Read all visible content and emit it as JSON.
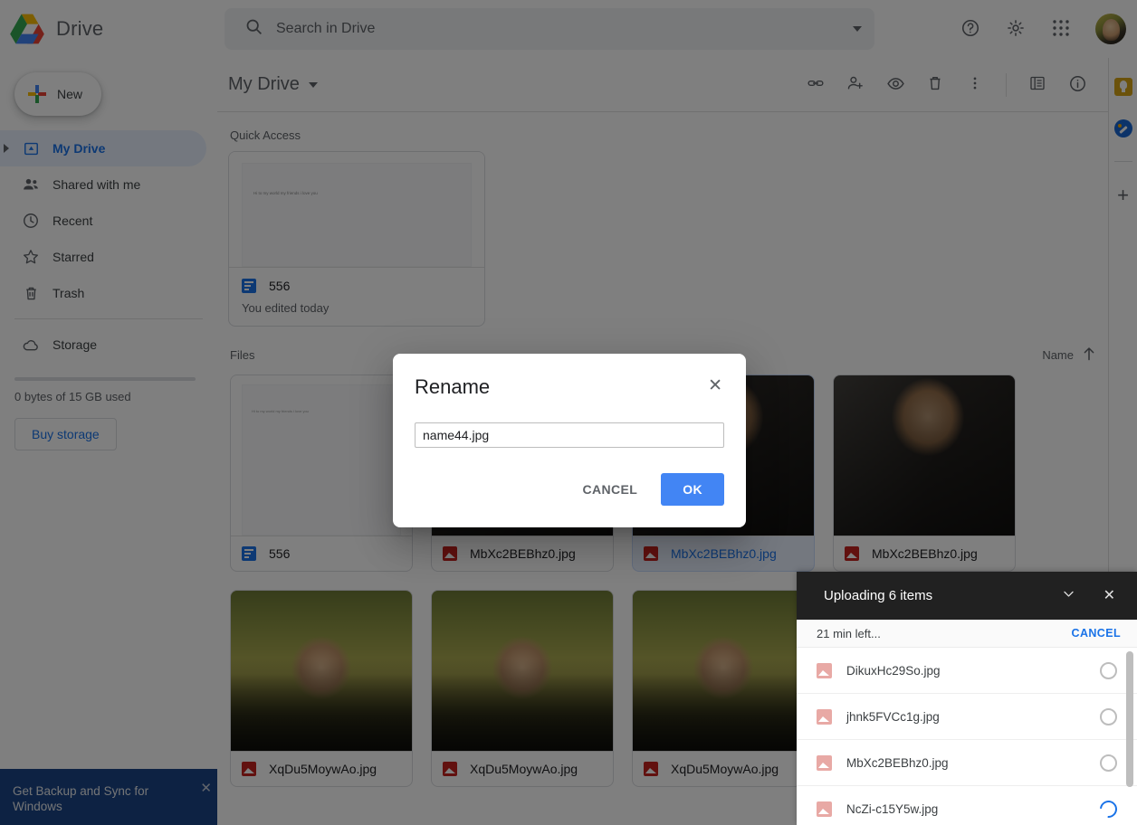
{
  "brand": {
    "title": "Drive",
    "logo_icon": "google-drive-logo"
  },
  "search": {
    "placeholder": "Search in Drive",
    "value": "",
    "search_icon": "search-icon",
    "options_icon": "chevron-down-icon"
  },
  "top_actions": [
    {
      "name": "help-button",
      "icon": "help-circle-icon"
    },
    {
      "name": "settings-button",
      "icon": "gear-icon"
    },
    {
      "name": "google-apps-button",
      "icon": "apps-grid-icon"
    },
    {
      "name": "account-avatar",
      "icon": "avatar"
    }
  ],
  "sidebar": {
    "new_button": {
      "label": "New",
      "icon": "plus-icon"
    },
    "items": [
      {
        "label": "My Drive",
        "icon": "my-drive-icon",
        "active": true,
        "expandable": true
      },
      {
        "label": "Shared with me",
        "icon": "people-icon",
        "active": false,
        "expandable": false
      },
      {
        "label": "Recent",
        "icon": "clock-icon",
        "active": false,
        "expandable": false
      },
      {
        "label": "Starred",
        "icon": "star-icon",
        "active": false,
        "expandable": false
      },
      {
        "label": "Trash",
        "icon": "trash-icon",
        "active": false,
        "expandable": false
      },
      {
        "label": "Storage",
        "icon": "cloud-icon",
        "active": false,
        "expandable": false
      }
    ],
    "storage_text": "0 bytes of 15 GB used",
    "storage_used_percent": 0,
    "buy_storage_label": "Buy storage",
    "banner": {
      "text": "Get Backup and Sync for Windows",
      "close_icon": "close-icon"
    }
  },
  "main": {
    "breadcrumb_title": "My Drive",
    "breadcrumb_icon": "chevron-down-icon",
    "toolbar_icons": [
      {
        "name": "get-link-button",
        "icon": "link-icon"
      },
      {
        "name": "share-button",
        "icon": "person-add-icon"
      },
      {
        "name": "preview-button",
        "icon": "eye-icon"
      },
      {
        "name": "remove-button",
        "icon": "trash-icon"
      },
      {
        "name": "more-actions-button",
        "icon": "more-vertical-icon"
      },
      {
        "name": "list-view-button",
        "icon": "list-view-icon"
      },
      {
        "name": "details-button",
        "icon": "info-icon"
      }
    ],
    "quick_access": {
      "heading": "Quick Access",
      "card": {
        "name": "556",
        "subtitle": "You edited today",
        "icon": "google-docs-icon",
        "preview_text": "Hi to my world my friends i love you"
      }
    },
    "files": {
      "heading": "Files",
      "sort_label": "Name",
      "sort_icon": "arrow-up-icon",
      "items": [
        {
          "name": "556",
          "icon": "google-docs-icon",
          "type": "doc",
          "selected": false,
          "preview_text": "Hi to my world my friends i love you"
        },
        {
          "name": "MbXc2BEBhz0.jpg",
          "icon": "image-icon",
          "type": "photo-suit",
          "selected": false
        },
        {
          "name": "MbXc2BEBhz0.jpg",
          "icon": "image-icon",
          "type": "photo-suit",
          "selected": true
        },
        {
          "name": "MbXc2BEBhz0.jpg",
          "icon": "image-icon",
          "type": "photo-suit",
          "selected": false
        },
        {
          "name": "XqDu5MoywAo.jpg",
          "icon": "image-icon",
          "type": "photo-outdoor",
          "selected": false
        },
        {
          "name": "XqDu5MoywAo.jpg",
          "icon": "image-icon",
          "type": "photo-outdoor",
          "selected": false
        },
        {
          "name": "XqDu5MoywAo.jpg",
          "icon": "image-icon",
          "type": "photo-outdoor",
          "selected": false
        }
      ]
    }
  },
  "right_rail": [
    {
      "name": "google-keep-button",
      "icon": "lightbulb-icon"
    },
    {
      "name": "google-tasks-button",
      "icon": "check-circle-icon"
    },
    {
      "name": "add-addon-button",
      "icon": "plus-icon"
    }
  ],
  "dialog": {
    "title": "Rename",
    "close_icon": "close-icon",
    "input_value": "name44.jpg",
    "cancel_label": "CANCEL",
    "ok_label": "OK"
  },
  "uploader": {
    "title": "Uploading 6 items",
    "collapse_icon": "chevron-down-icon",
    "close_icon": "close-icon",
    "status": "21 min left...",
    "cancel_label": "CANCEL",
    "items": [
      {
        "name": "DikuxHc29So.jpg",
        "icon": "image-icon",
        "uploading": false
      },
      {
        "name": "jhnk5FVCc1g.jpg",
        "icon": "image-icon",
        "uploading": false
      },
      {
        "name": "MbXc2BEBhz0.jpg",
        "icon": "image-icon",
        "uploading": false
      },
      {
        "name": "NcZi-c15Y5w.jpg",
        "icon": "image-icon",
        "uploading": true
      }
    ]
  },
  "colors": {
    "accent_blue": "#1a73e8",
    "primary_button": "#4285f4",
    "selected_bg": "#e8f0fe",
    "banner_blue": "#1a4587",
    "uploader_header": "#212121",
    "image_icon_red": "#c5221f"
  }
}
